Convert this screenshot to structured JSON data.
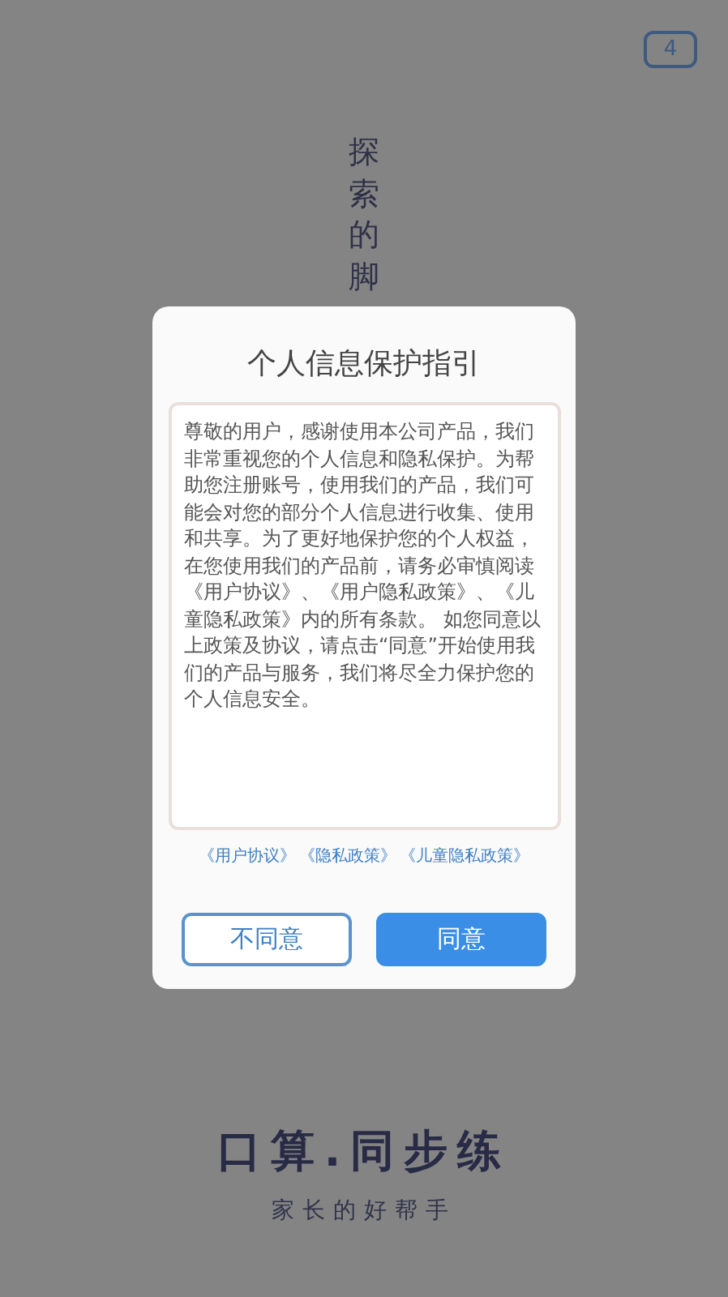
{
  "countdown": "4",
  "vertical_slogan": "探索的脚",
  "dialog": {
    "title": "个人信息保护指引",
    "body": "尊敬的用户，感谢使用本公司产品，我们非常重视您的个人信息和隐私保护。为帮助您注册账号，使用我们的产品，我们可能会对您的部分个人信息进行收集、使用和共享。为了更好地保护您的个人权益，在您使用我们的产品前，请务必审慎阅读《用户协议》、《用户隐私政策》、《儿童隐私政策》内的所有条款。 如您同意以上政策及协议，请点击“同意”开始使用我们的产品与服务，我们将尽全力保护您的个人信息安全。",
    "links": [
      "《用户协议》",
      "《隐私政策》",
      "《儿童隐私政策》"
    ],
    "buttons": [
      {
        "label": "不同意",
        "kind": "outline"
      },
      {
        "label": "同意",
        "kind": "primary"
      }
    ]
  },
  "app_title": "口算.同步练",
  "app_subtitle": "家长的好帮手"
}
